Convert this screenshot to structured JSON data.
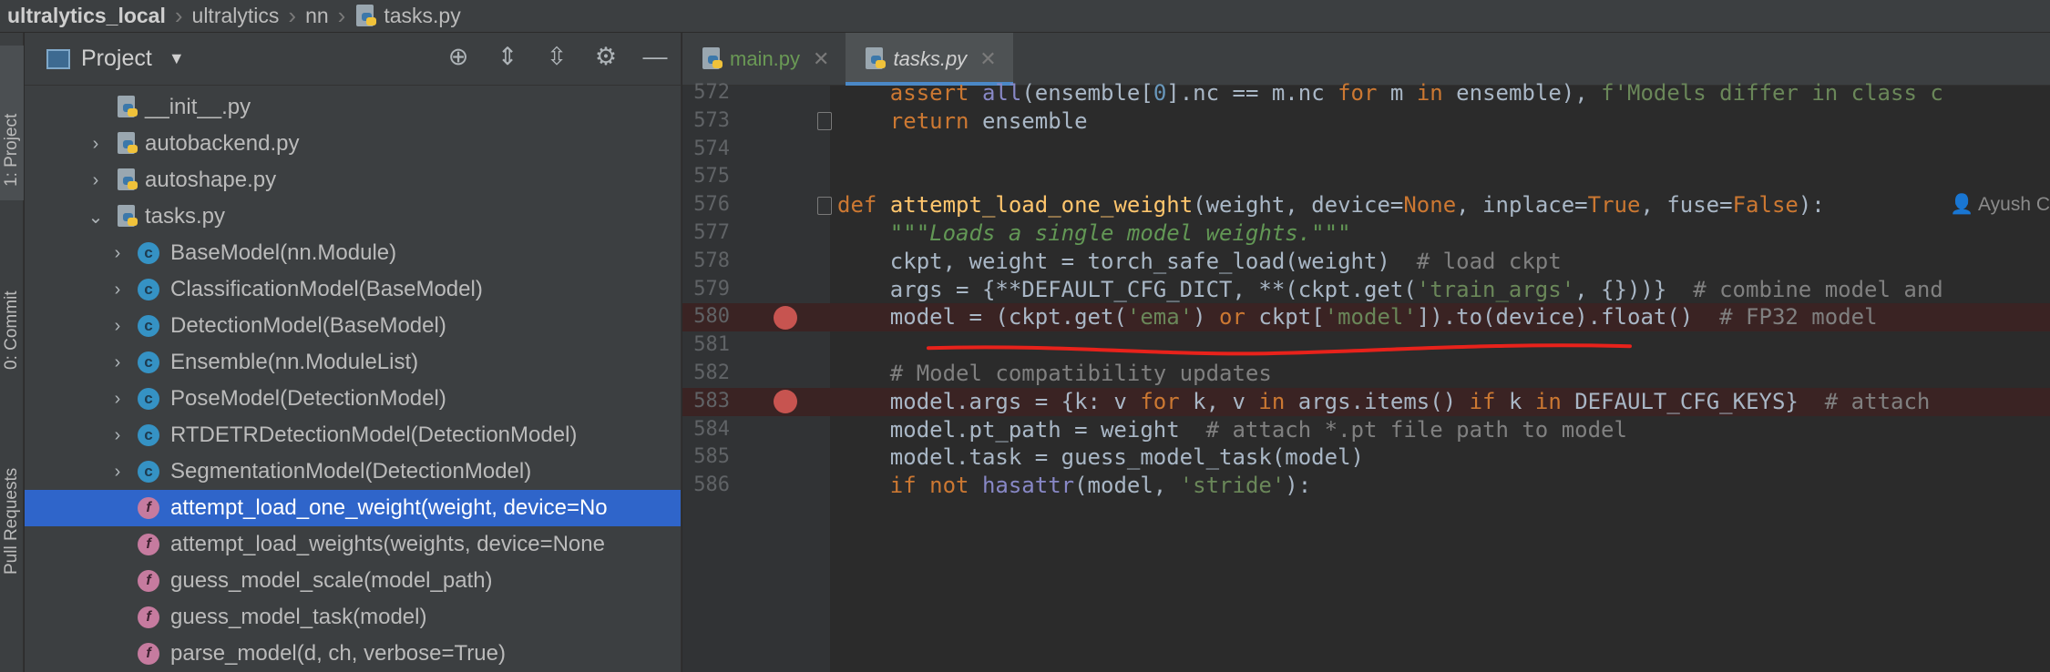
{
  "breadcrumb": {
    "items": [
      "ultralytics_local",
      "ultralytics",
      "nn",
      "tasks.py"
    ]
  },
  "toolstrip": {
    "project": "1: Project",
    "commit": "0: Commit",
    "pull_requests": "Pull Requests"
  },
  "project_panel": {
    "title": "Project",
    "tree": [
      {
        "label": "__init__.py",
        "kind": "file",
        "arrow": ""
      },
      {
        "label": "autobackend.py",
        "kind": "file",
        "arrow": "›"
      },
      {
        "label": "autoshape.py",
        "kind": "file",
        "arrow": "›"
      },
      {
        "label": "tasks.py",
        "kind": "file",
        "arrow": "⌄"
      },
      {
        "label": "BaseModel(nn.Module)",
        "kind": "class",
        "arrow": "›"
      },
      {
        "label": "ClassificationModel(BaseModel)",
        "kind": "class",
        "arrow": "›"
      },
      {
        "label": "DetectionModel(BaseModel)",
        "kind": "class",
        "arrow": "›"
      },
      {
        "label": "Ensemble(nn.ModuleList)",
        "kind": "class",
        "arrow": "›"
      },
      {
        "label": "PoseModel(DetectionModel)",
        "kind": "class",
        "arrow": "›"
      },
      {
        "label": "RTDETRDetectionModel(DetectionModel)",
        "kind": "class",
        "arrow": "›"
      },
      {
        "label": "SegmentationModel(DetectionModel)",
        "kind": "class",
        "arrow": "›"
      },
      {
        "label": "attempt_load_one_weight(weight, device=No",
        "kind": "function",
        "arrow": "",
        "selected": true
      },
      {
        "label": "attempt_load_weights(weights, device=None",
        "kind": "function",
        "arrow": ""
      },
      {
        "label": "guess_model_scale(model_path)",
        "kind": "function",
        "arrow": ""
      },
      {
        "label": "guess_model_task(model)",
        "kind": "function",
        "arrow": ""
      },
      {
        "label": "parse_model(d, ch, verbose=True)",
        "kind": "function",
        "arrow": ""
      }
    ]
  },
  "tabs": [
    {
      "label": "main.py",
      "active": false
    },
    {
      "label": "tasks.py",
      "active": true
    }
  ],
  "editor": {
    "author_hint": "Ayush C",
    "lines": [
      {
        "n": "572",
        "html": "    <span class='kw'>assert</span> <span class='bi'>all</span>(ensemble[<span class='num'>0</span>].nc == m.nc <span class='kw'>for</span> m <span class='kw'>in</span> ensemble), <span class='str'>f'Models differ in class c</span>"
      },
      {
        "n": "573",
        "html": "    <span class='kw'>return</span> ensemble",
        "fold": true
      },
      {
        "n": "574",
        "html": ""
      },
      {
        "n": "575",
        "html": ""
      },
      {
        "n": "576",
        "html": "<span class='kw'>def</span> <span class='fn'>attempt_load_one_weight</span>(weight, device=<span class='kw'>None</span>, inplace=<span class='kw'>True</span>, fuse=<span class='kw'>False</span>):",
        "fold": true
      },
      {
        "n": "577",
        "html": "    <span class='doc'>\"\"\"Loads a single model weights.\"\"\"</span>"
      },
      {
        "n": "578",
        "html": "    ckpt, weight = torch_safe_load(weight)  <span class='cm'># load ckpt</span>"
      },
      {
        "n": "579",
        "html": "    args = {**DEFAULT_CFG_DICT, **(ckpt.get(<span class='str'>'train_args'</span>, {}))}  <span class='cm'># combine model and</span>"
      },
      {
        "n": "580",
        "html": "    model = (ckpt.get(<span class='str'>'ema'</span>) <span class='kw'>or</span> ckpt[<span class='str'>'model'</span>]).to(device).float()  <span class='cm'># FP32 model</span>",
        "bp": true
      },
      {
        "n": "581",
        "html": ""
      },
      {
        "n": "582",
        "html": "    <span class='cm'># Model compatibility updates</span>"
      },
      {
        "n": "583",
        "html": "    model.args = {k: v <span class='kw'>for</span> k, v <span class='kw'>in</span> args.items() <span class='kw'>if</span> k <span class='kw'>in</span> DEFAULT_CFG_KEYS}  <span class='cm'># attach</span>",
        "bp": true
      },
      {
        "n": "584",
        "html": "    model.pt_path = weight  <span class='cm'># attach *.pt file path to model</span>"
      },
      {
        "n": "585",
        "html": "    model.task = guess_model_task(model)"
      },
      {
        "n": "586",
        "html": "    <span class='kw'>if not</span> <span class='bi'>hasattr</span>(model, <span class='str'>'stride'</span>):"
      }
    ]
  },
  "colors": {
    "selection": "#2f65ca",
    "breakpoint": "#c75450",
    "annotation_stroke": "#e8221b"
  }
}
